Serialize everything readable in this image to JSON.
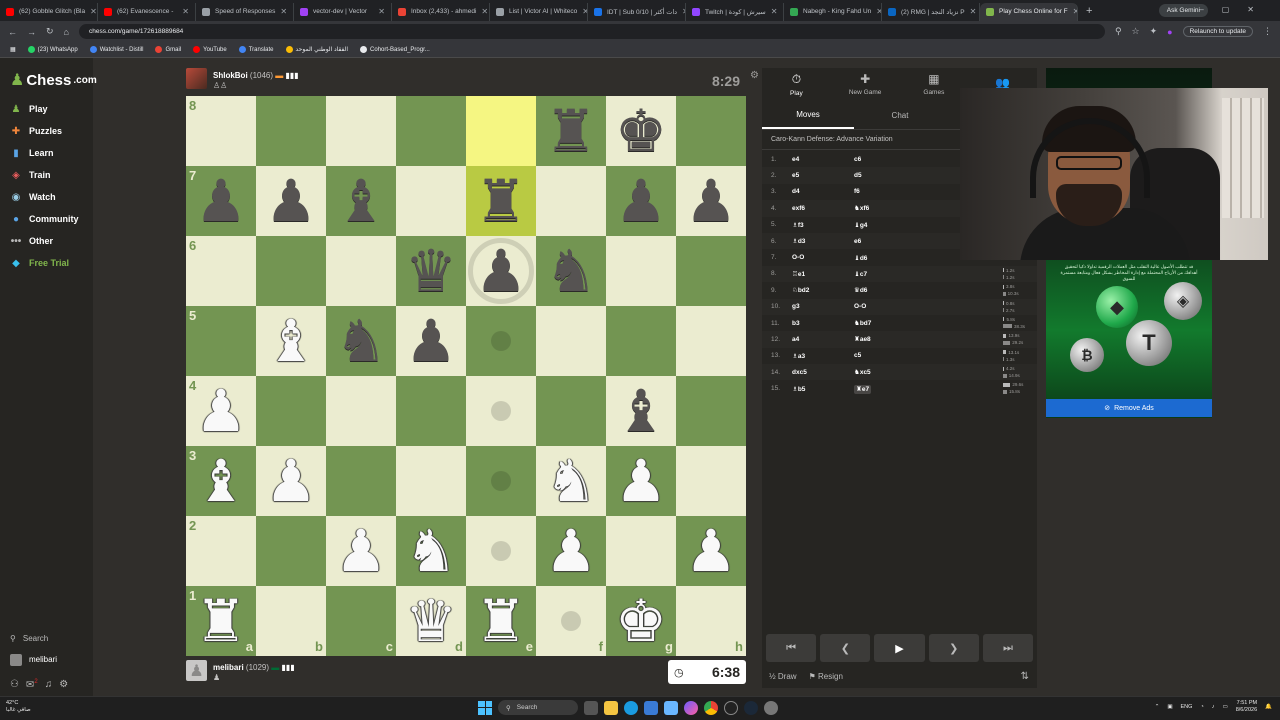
{
  "browser": {
    "tabs": [
      {
        "label": "(62) Gobble Glitch (Bla",
        "color": "#ff0000"
      },
      {
        "label": "(62) Evanescence -",
        "color": "#ff0000"
      },
      {
        "label": "Speed of Responses",
        "color": "#9aa0a6"
      },
      {
        "label": "vector-dev | Vector",
        "color": "#a142f4"
      },
      {
        "label": "Inbox (2,433) - ahmedi",
        "color": "#ea4335"
      },
      {
        "label": "List | Victor AI | Whiteco",
        "color": "#9aa0a6"
      },
      {
        "label": "IDT | Sub 0/10 | دات أكثر",
        "color": "#1a73e8"
      },
      {
        "label": "Twitch | سيرش | كودة",
        "color": "#9146ff"
      },
      {
        "label": "Nabegh - King Fahd Un",
        "color": "#34a853"
      },
      {
        "label": "(2) RMG | نزياد النجد P",
        "color": "#0a66c2"
      },
      {
        "label": "Play Chess Online for F",
        "color": "#81b64c"
      }
    ],
    "ask_gemini": "Ask Gemini",
    "url": "chess.com/game/172618889684",
    "relaunch": "Relaunch to update",
    "bookmarks": [
      {
        "label": "(23) WhatsApp",
        "color": "#25d366"
      },
      {
        "label": "Watchlist - Distill",
        "color": "#4285f4"
      },
      {
        "label": "Gmail",
        "color": "#ea4335"
      },
      {
        "label": "YouTube",
        "color": "#ff0000"
      },
      {
        "label": "Translate",
        "color": "#4285f4"
      },
      {
        "label": "الفقاد الوطني الموحد",
        "color": "#fbbc05"
      },
      {
        "label": "Cohort-Based_Progr...",
        "color": "#e8eaed"
      }
    ]
  },
  "site": {
    "logo": "Chess",
    "logo_suffix": ".com",
    "nav": [
      {
        "label": "Play",
        "icon": "♟",
        "color": "#81b64c"
      },
      {
        "label": "Puzzles",
        "icon": "✚",
        "color": "#f1863b"
      },
      {
        "label": "Learn",
        "icon": "▮",
        "color": "#5aa4e6"
      },
      {
        "label": "Train",
        "icon": "◈",
        "color": "#e85c5c"
      },
      {
        "label": "Watch",
        "icon": "◉",
        "color": "#9acde6"
      },
      {
        "label": "Community",
        "icon": "●",
        "color": "#5aa4e6"
      },
      {
        "label": "Other",
        "icon": "•••",
        "color": "#bababa"
      },
      {
        "label": "Free Trial",
        "icon": "◆",
        "color": "#39c0ed"
      }
    ],
    "search": "Search",
    "username": "melibari",
    "notif_count": "2"
  },
  "game": {
    "top_player": {
      "name": "ShlokBoi",
      "rating": "(1046)",
      "clock": "8:29"
    },
    "bottom_player": {
      "name": "melibari",
      "rating": "(1029)",
      "clock": "6:38"
    },
    "board": [
      [
        "",
        "",
        "",
        "",
        "",
        "br",
        "bk",
        ""
      ],
      [
        "bp",
        "bp",
        "bb",
        "",
        "br",
        "",
        "bp",
        "bp"
      ],
      [
        "",
        "",
        "",
        "bq",
        "bp",
        "bn",
        "",
        ""
      ],
      [
        "",
        "wb",
        "bn",
        "bp",
        "",
        "",
        "",
        ""
      ],
      [
        "wp",
        "",
        "",
        "",
        "",
        "",
        "bb",
        ""
      ],
      [
        "wb",
        "wp",
        "",
        "",
        "",
        "wn",
        "wp",
        ""
      ],
      [
        "",
        "",
        "wp",
        "wn",
        "",
        "wp",
        "",
        "wp"
      ],
      [
        "wr",
        "",
        "",
        "wq",
        "wr",
        "",
        "wk",
        ""
      ]
    ],
    "highlights": [
      [
        0,
        4
      ],
      [
        1,
        4
      ]
    ],
    "dots": [
      [
        3,
        4
      ],
      [
        4,
        4
      ],
      [
        5,
        4
      ],
      [
        6,
        4
      ],
      [
        7,
        5
      ]
    ],
    "ring": [
      2,
      4
    ],
    "rank_labels": [
      "8",
      "7",
      "6",
      "5",
      "4",
      "3",
      "2",
      "1"
    ],
    "file_labels": [
      "a",
      "b",
      "c",
      "d",
      "e",
      "f",
      "g",
      "h"
    ]
  },
  "panel": {
    "tabs": [
      {
        "label": "Play",
        "icon": "⏱",
        "active": true
      },
      {
        "label": "New Game",
        "icon": "✚",
        "active": false
      },
      {
        "label": "Games",
        "icon": "▦",
        "active": false
      },
      {
        "label": "",
        "icon": "👥",
        "active": false
      }
    ],
    "subtabs": [
      "Moves",
      "Chat"
    ],
    "opening": "Caro-Kann Defense: Advance Variation",
    "moves": [
      {
        "n": "1.",
        "w": "e4",
        "b": "c6"
      },
      {
        "n": "2.",
        "w": "e5",
        "b": "d5"
      },
      {
        "n": "3.",
        "w": "d4",
        "b": "f6"
      },
      {
        "n": "4.",
        "w": "exf6",
        "b": "♞xf6"
      },
      {
        "n": "5.",
        "w": "♗f3",
        "b": "♝g4"
      },
      {
        "n": "6.",
        "w": "♗d3",
        "b": "e6"
      },
      {
        "n": "7.",
        "w": "O-O",
        "b": "♝d6"
      },
      {
        "n": "8.",
        "w": "♖e1",
        "b": "♝c7"
      },
      {
        "n": "9.",
        "w": "♘bd2",
        "b": "♛d6"
      },
      {
        "n": "10.",
        "w": "g3",
        "b": "O-O"
      },
      {
        "n": "11.",
        "w": "b3",
        "b": "♞bd7"
      },
      {
        "n": "12.",
        "w": "a4",
        "b": "♜ae8"
      },
      {
        "n": "13.",
        "w": "♗a3",
        "b": "c5"
      },
      {
        "n": "14.",
        "w": "dxc5",
        "b": "♞xc5"
      },
      {
        "n": "15.",
        "w": "♗b5",
        "b": "♜e7"
      }
    ],
    "move_times": [
      [
        "",
        ""
      ],
      [
        "",
        ""
      ],
      [
        "",
        ""
      ],
      [
        "",
        ""
      ],
      [
        "",
        ""
      ],
      [
        "",
        ""
      ],
      [
        "",
        ""
      ],
      [
        "1.2s",
        "1.2s"
      ],
      [
        "3.8s",
        "10.3s"
      ],
      [
        "0.8s",
        "2.7s"
      ],
      [
        "5.8s",
        "38.3s"
      ],
      [
        "13.9s",
        "29.2s"
      ],
      [
        "13.1s",
        "1.3s"
      ],
      [
        "4.2s",
        "14.9s"
      ],
      [
        "29.6s",
        "15.8s"
      ]
    ],
    "draw": "Draw",
    "resign": "Resign"
  },
  "ad": {
    "text": "قد تتطلب الأصول عالية التقلب مثل العملات الرقمية تداولا ذكيا لتحقيق أهدافك من الأرباح المحتملة مع إدارة المخاطر بشكل فعال ومتابعة مستمرة للسوق",
    "remove": "Remove Ads"
  },
  "taskbar": {
    "temp": "42°C",
    "weather": "صافي غالبا",
    "search": "Search",
    "lang": "ENG",
    "time": "7:51 PM",
    "date": "8/6/2026"
  }
}
